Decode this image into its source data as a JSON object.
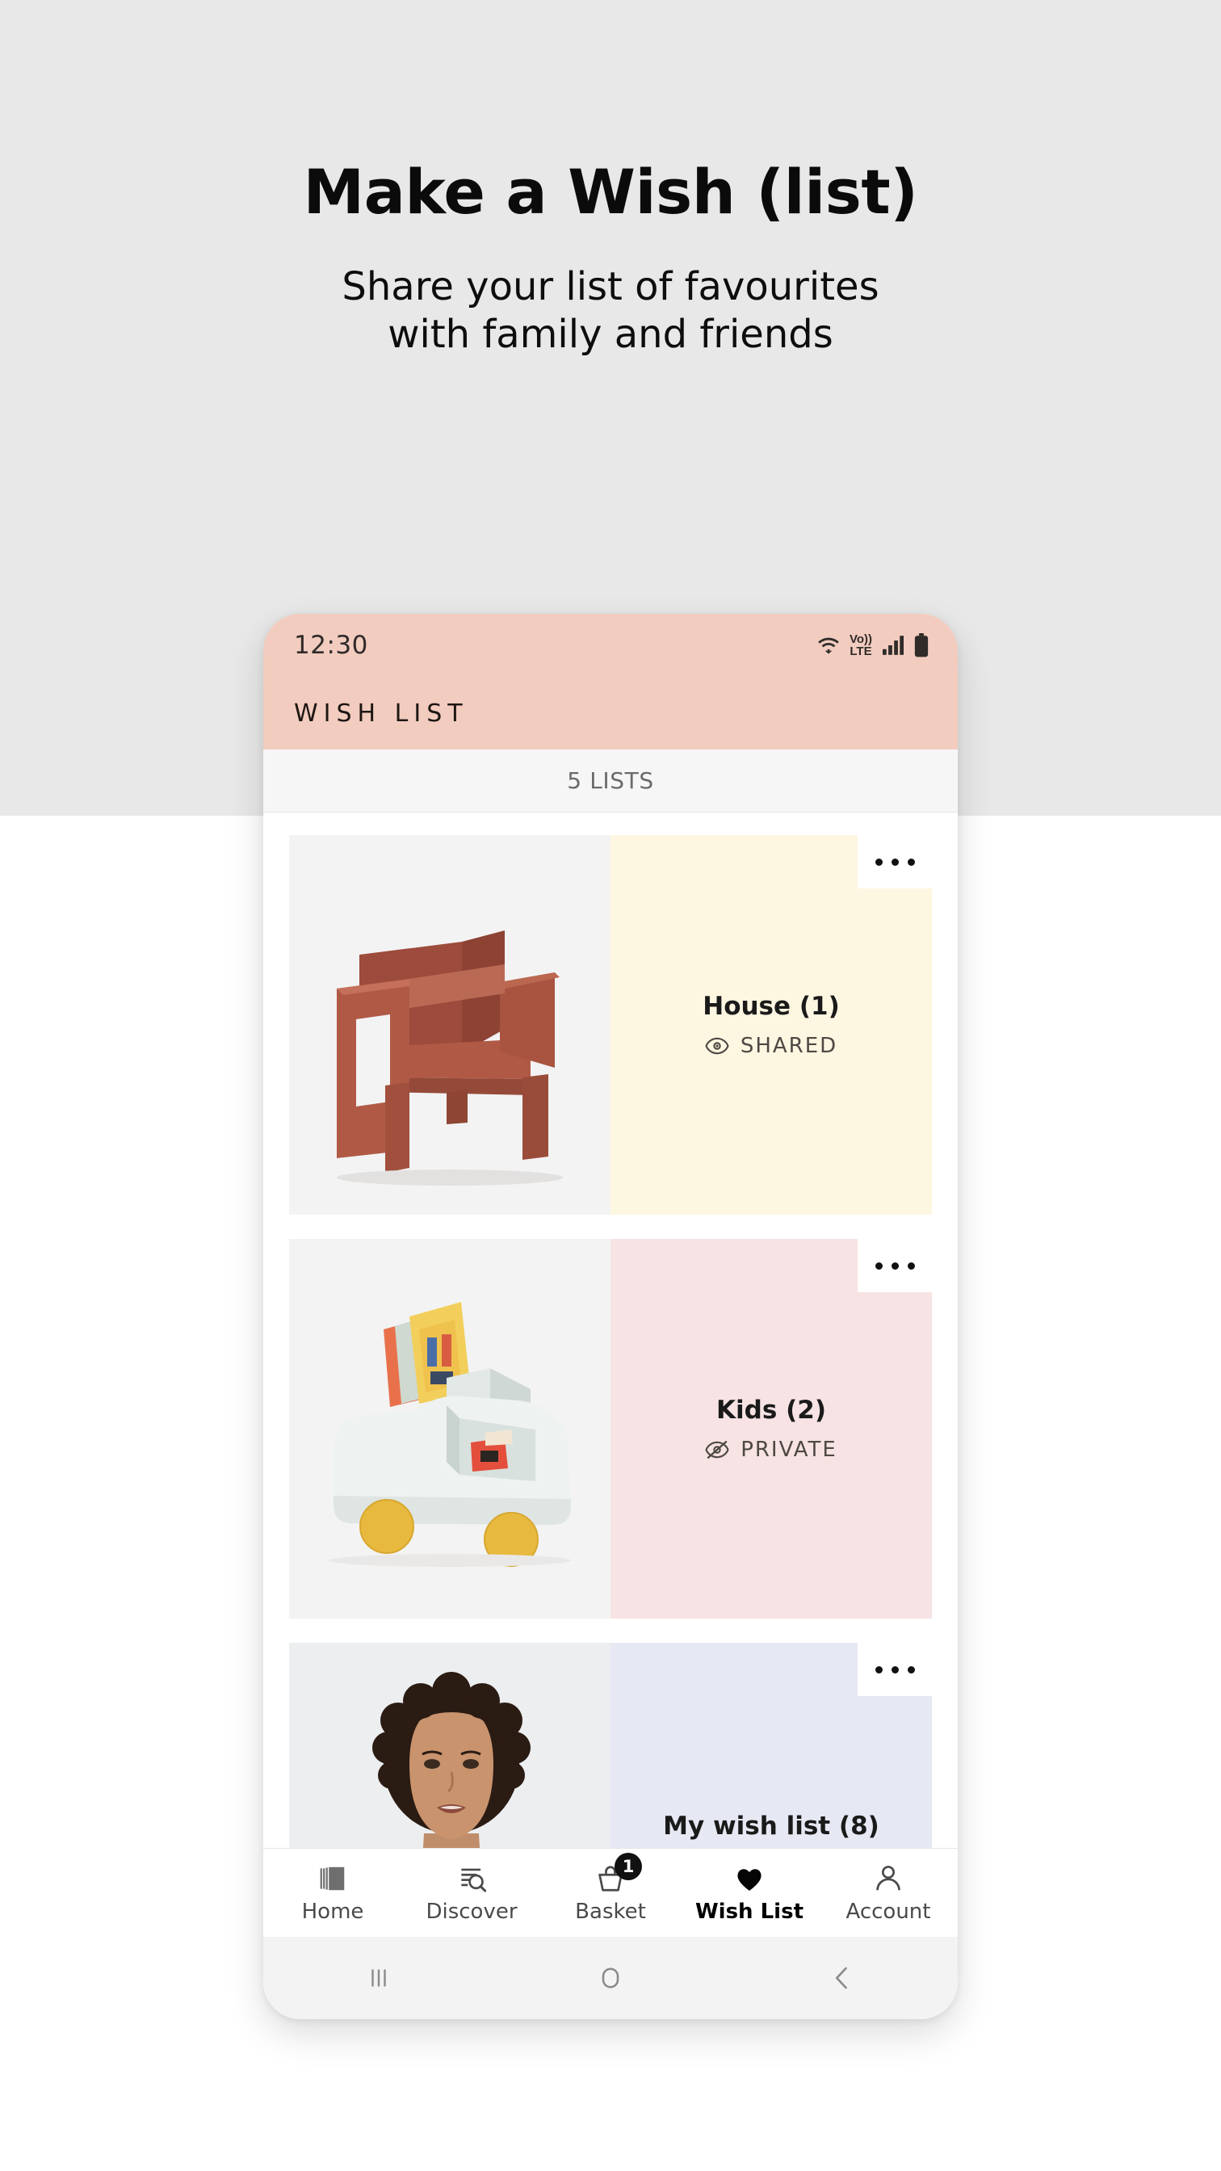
{
  "promo": {
    "title": "Make a Wish (list)",
    "subtitle_line1": "Share your list of favourites",
    "subtitle_line2": "with family and friends",
    "background": "#e8e8e8"
  },
  "phone": {
    "status_bar": {
      "time": "12:30",
      "wifi_icon": "wifi-icon",
      "volte_top": "Vo))",
      "volte_bottom": "LTE",
      "signal_icon": "signal-bars-icon",
      "battery_icon": "battery-icon",
      "background": "#f2ccbf"
    },
    "app_header": {
      "title": "WISH LIST",
      "background": "#f2ccbf"
    },
    "count_bar": {
      "text": "5 LISTS"
    },
    "lists": [
      {
        "name": "House (1)",
        "privacy": "SHARED",
        "privacy_icon": "eye-icon",
        "panel_color": "#fdf6e1",
        "thumb": "rust-velvet-armchair",
        "menu_icon": "more-options-icon"
      },
      {
        "name": "Kids (2)",
        "privacy": "PRIVATE",
        "privacy_icon": "eye-off-icon",
        "panel_color": "#f7e3e3",
        "thumb": "car-shaped-toy-storage-box",
        "menu_icon": "more-options-icon"
      },
      {
        "name": "My wish list (8)",
        "privacy": "",
        "privacy_icon": "",
        "panel_color": "#e6e8f3",
        "thumb": "woman-in-green-cardigan",
        "menu_icon": "more-options-icon"
      }
    ],
    "tabs": [
      {
        "label": "Home",
        "icon": "home-book-icon",
        "active": false,
        "badge": ""
      },
      {
        "label": "Discover",
        "icon": "search-list-icon",
        "active": false,
        "badge": ""
      },
      {
        "label": "Basket",
        "icon": "basket-icon",
        "active": false,
        "badge": "1"
      },
      {
        "label": "Wish List",
        "icon": "heart-filled-icon",
        "active": true,
        "badge": ""
      },
      {
        "label": "Account",
        "icon": "person-icon",
        "active": false,
        "badge": ""
      }
    ],
    "system_nav": [
      {
        "icon": "recents-icon"
      },
      {
        "icon": "home-circle-icon"
      },
      {
        "icon": "back-chevron-icon"
      }
    ]
  }
}
